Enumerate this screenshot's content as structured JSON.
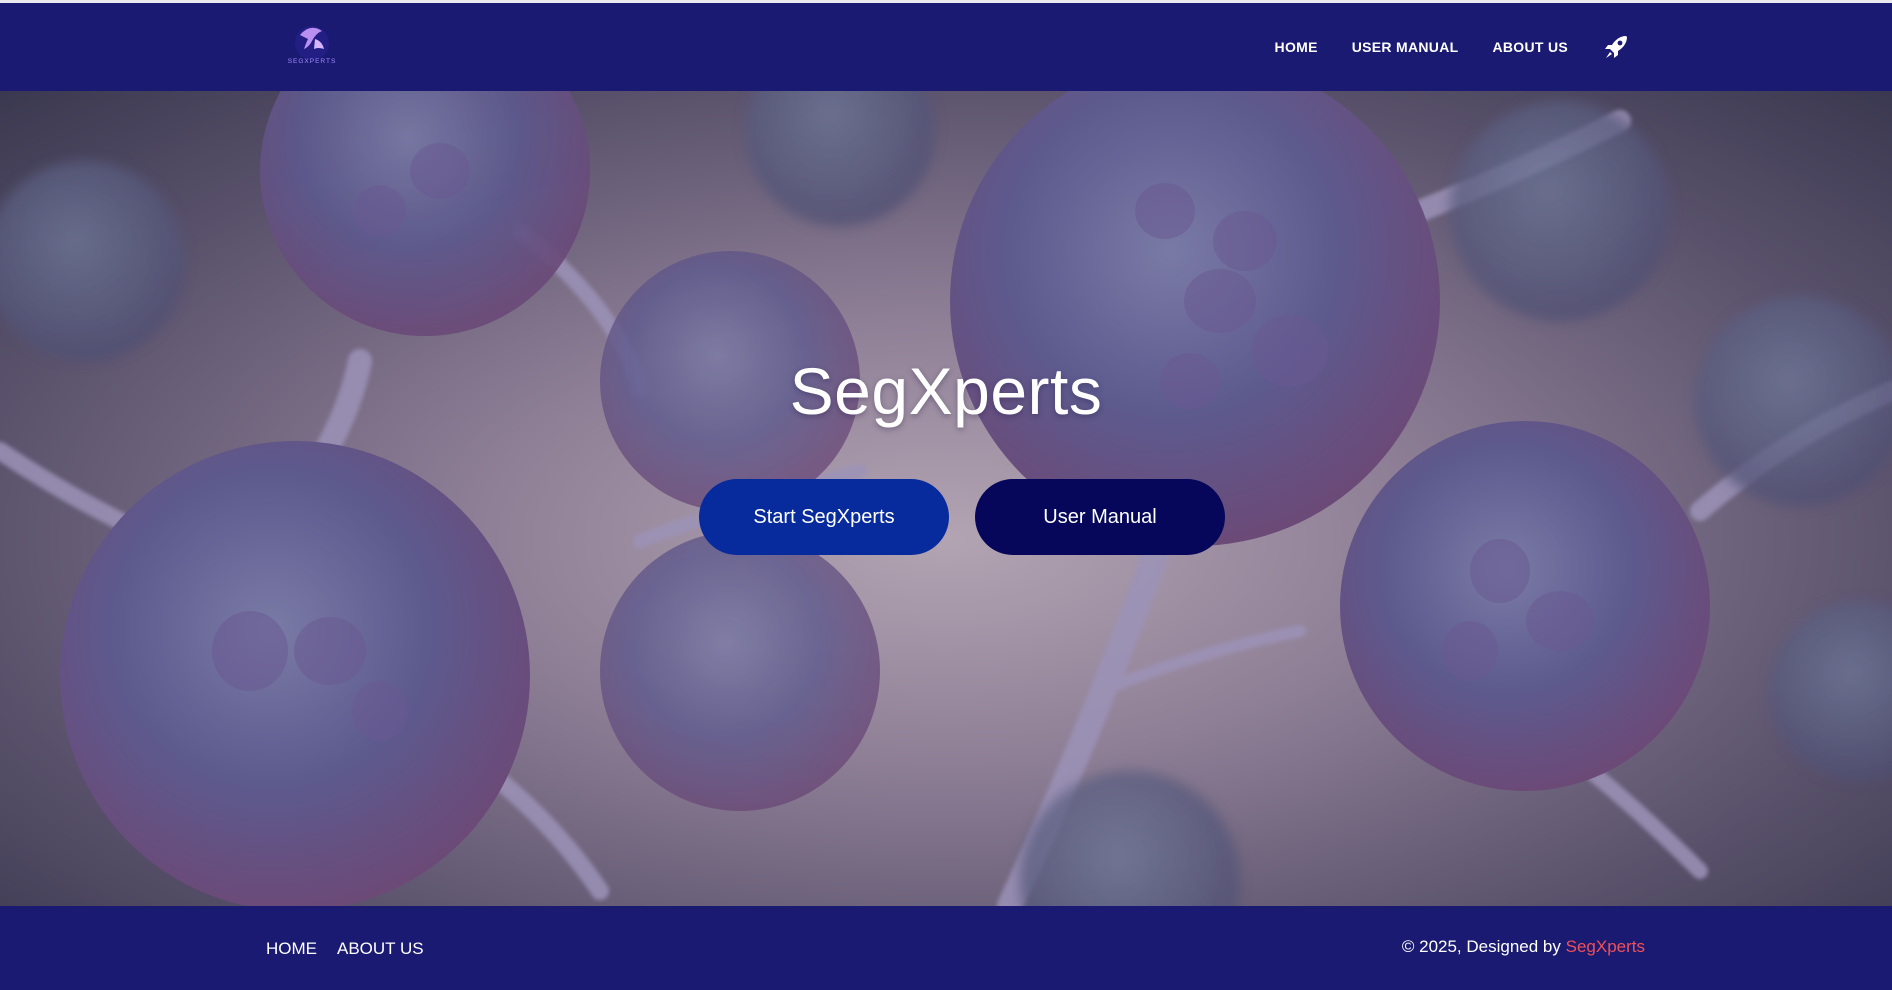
{
  "header": {
    "logo_text": "SEGXPERTS",
    "nav": [
      {
        "label": "HOME"
      },
      {
        "label": "USER MANUAL"
      },
      {
        "label": "ABOUT US"
      }
    ],
    "rocket_icon": "rocket-icon"
  },
  "hero": {
    "title": "SegXperts",
    "primary_button": "Start SegXperts",
    "secondary_button": "User Manual"
  },
  "footer": {
    "links": [
      {
        "label": "HOME"
      },
      {
        "label": "ABOUT US"
      }
    ],
    "copyright_prefix": "© 2025, Designed by ",
    "copyright_brand": "SegXperts"
  },
  "colors": {
    "header_bg": "#1a1a72",
    "primary_button": "#072b9c",
    "secondary_button": "#06065a",
    "brand_accent": "#f0505a"
  }
}
